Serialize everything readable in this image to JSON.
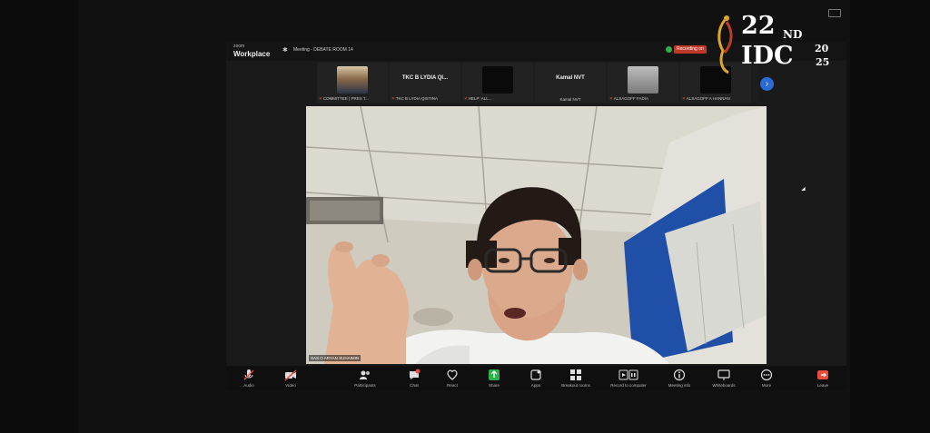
{
  "branding": {
    "event_number": "22",
    "event_suffix": "ND",
    "event_name": "IDC",
    "year_top": "20",
    "year_bottom": "25"
  },
  "zoom": {
    "app_small": "zoom",
    "app_name": "Workplace",
    "meeting_label": "Meeting - DEBATE ROOM 14",
    "recording_label": "Recording on"
  },
  "participants": [
    {
      "name": "",
      "label": "COMMITTEE | PRES T..."
    },
    {
      "name": "TKC B LYDIA QI...",
      "label": "TKC B LYDIA QISTINA"
    },
    {
      "name": "",
      "label": "HELP: ALL..."
    },
    {
      "name": "Kamal NVT",
      "label": "Kamal NVT"
    },
    {
      "name": "",
      "label": "ALSAGOFF FADIA"
    },
    {
      "name": "",
      "label": "ALSAGOFF A HANNAN"
    }
  ],
  "speaker": {
    "label": "SAS O ARYAN SUHAIMIN"
  },
  "toolbar": [
    {
      "icon": "mic-muted-icon",
      "label": "Audio"
    },
    {
      "icon": "video-off-icon",
      "label": "Video"
    },
    {
      "icon": "participants-icon",
      "label": "Participants",
      "count": "7"
    },
    {
      "icon": "chat-icon",
      "label": "Chat"
    },
    {
      "icon": "react-icon",
      "label": "React"
    },
    {
      "icon": "share-icon",
      "label": "Share"
    },
    {
      "icon": "apps-icon",
      "label": "Apps"
    },
    {
      "icon": "breakout-rooms-icon",
      "label": "Breakout rooms"
    },
    {
      "icon": "record-icon",
      "label": "Record to computer"
    },
    {
      "icon": "info-icon",
      "label": "Meeting info"
    },
    {
      "icon": "whiteboard-icon",
      "label": "Whiteboards"
    },
    {
      "icon": "more-icon",
      "label": "More"
    },
    {
      "icon": "leave-icon",
      "label": "Leave"
    }
  ],
  "colors": {
    "accent": "#2a6ad6",
    "share": "#2bb24c",
    "alert": "#e74c3c"
  }
}
